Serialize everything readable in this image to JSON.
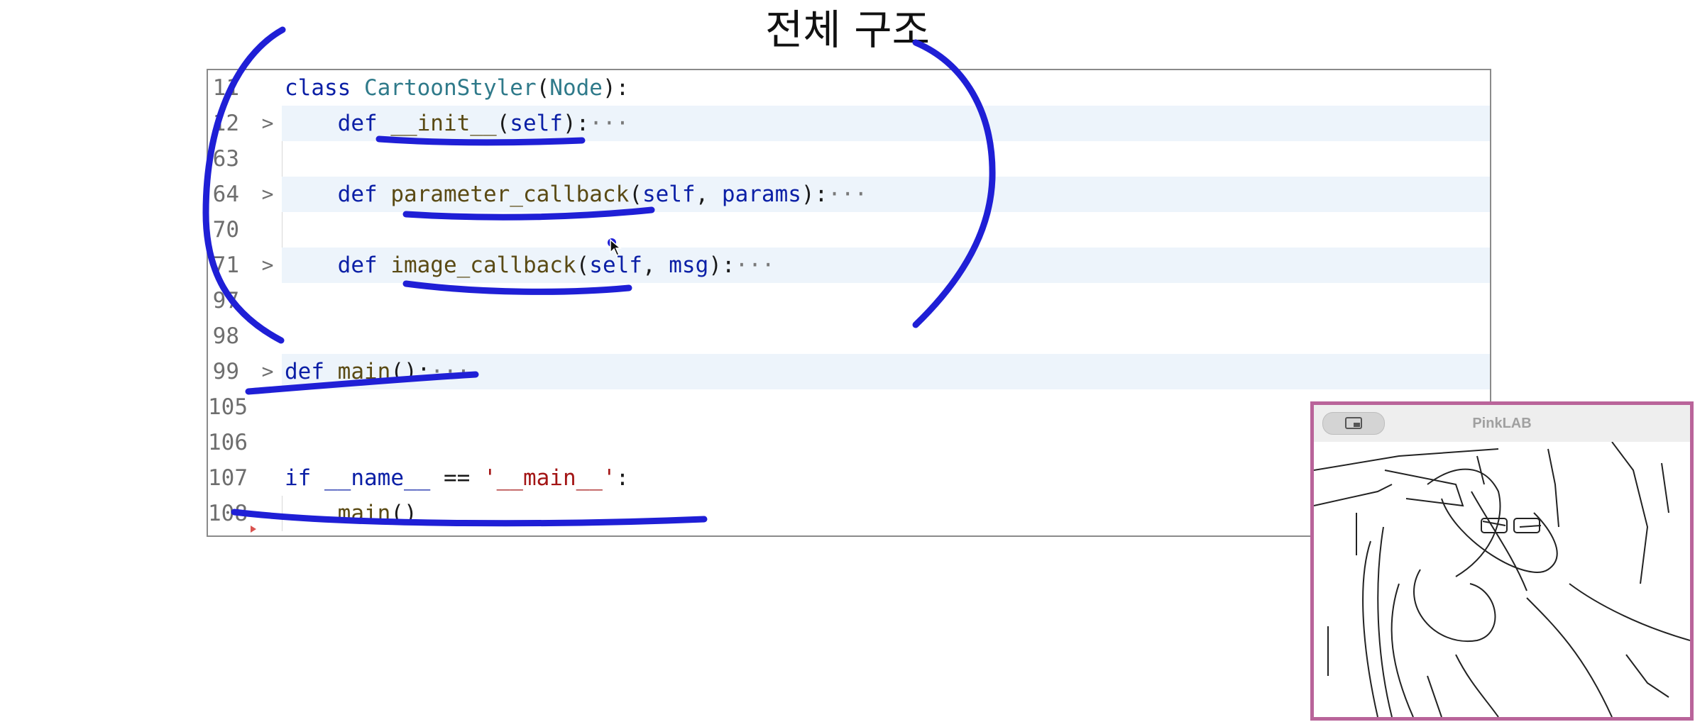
{
  "slide_title": "전체 구조",
  "editor": {
    "lines": [
      {
        "num": "11",
        "fold": false,
        "shaded": false,
        "guide": false,
        "indent": 0,
        "tokens": [
          {
            "t": "class ",
            "c": "kw"
          },
          {
            "t": "CartoonStyler",
            "c": "cls"
          },
          {
            "t": "(",
            "c": ""
          },
          {
            "t": "Node",
            "c": "cls"
          },
          {
            "t": "):",
            "c": ""
          }
        ]
      },
      {
        "num": "12",
        "fold": true,
        "shaded": true,
        "guide": true,
        "indent": 1,
        "tokens": [
          {
            "t": "def ",
            "c": "kw"
          },
          {
            "t": "__init__",
            "c": "fn"
          },
          {
            "t": "(",
            "c": ""
          },
          {
            "t": "self",
            "c": "kw"
          },
          {
            "t": "):",
            "c": ""
          },
          {
            "t": "···",
            "c": "ellipsis"
          }
        ]
      },
      {
        "num": "63",
        "fold": false,
        "shaded": false,
        "guide": true,
        "indent": 0,
        "tokens": []
      },
      {
        "num": "64",
        "fold": true,
        "shaded": true,
        "guide": true,
        "indent": 1,
        "tokens": [
          {
            "t": "def ",
            "c": "kw"
          },
          {
            "t": "parameter_callback",
            "c": "fn"
          },
          {
            "t": "(",
            "c": ""
          },
          {
            "t": "self",
            "c": "kw"
          },
          {
            "t": ", ",
            "c": ""
          },
          {
            "t": "params",
            "c": "kw"
          },
          {
            "t": "):",
            "c": ""
          },
          {
            "t": "···",
            "c": "ellipsis"
          }
        ]
      },
      {
        "num": "70",
        "fold": false,
        "shaded": false,
        "guide": true,
        "indent": 0,
        "tokens": []
      },
      {
        "num": "71",
        "fold": true,
        "shaded": true,
        "guide": true,
        "indent": 1,
        "tokens": [
          {
            "t": "def ",
            "c": "kw"
          },
          {
            "t": "image_callback",
            "c": "fn"
          },
          {
            "t": "(",
            "c": ""
          },
          {
            "t": "self",
            "c": "kw"
          },
          {
            "t": ", ",
            "c": ""
          },
          {
            "t": "msg",
            "c": "kw"
          },
          {
            "t": "):",
            "c": ""
          },
          {
            "t": "···",
            "c": "ellipsis"
          }
        ]
      },
      {
        "num": "97",
        "fold": false,
        "shaded": false,
        "guide": false,
        "indent": 0,
        "tokens": []
      },
      {
        "num": "98",
        "fold": false,
        "shaded": false,
        "guide": false,
        "indent": 0,
        "tokens": []
      },
      {
        "num": "99",
        "fold": true,
        "shaded": true,
        "guide": false,
        "indent": 0,
        "tokens": [
          {
            "t": "def ",
            "c": "kw"
          },
          {
            "t": "main",
            "c": "fn"
          },
          {
            "t": "():",
            "c": ""
          },
          {
            "t": "···",
            "c": "ellipsis"
          }
        ]
      },
      {
        "num": "105",
        "fold": false,
        "shaded": false,
        "guide": false,
        "indent": 0,
        "tokens": []
      },
      {
        "num": "106",
        "fold": false,
        "shaded": false,
        "guide": false,
        "indent": 0,
        "tokens": []
      },
      {
        "num": "107",
        "fold": false,
        "shaded": false,
        "guide": false,
        "indent": 0,
        "tokens": [
          {
            "t": "if ",
            "c": "kw"
          },
          {
            "t": "__name__",
            "c": "kw"
          },
          {
            "t": " == ",
            "c": ""
          },
          {
            "t": "'__main__'",
            "c": "str"
          },
          {
            "t": ":",
            "c": ""
          }
        ]
      },
      {
        "num": "108",
        "fold": false,
        "shaded": false,
        "guide": true,
        "indent": 1,
        "tokens": [
          {
            "t": "main",
            "c": "fn"
          },
          {
            "t": "()",
            "c": ""
          }
        ]
      }
    ],
    "fold_glyph": ">"
  },
  "pip_window": {
    "title": "PinkLAB",
    "button_icon": "picture-in-picture-icon",
    "border_color": "#b9649a"
  },
  "annotation_color": "#1f1fd6"
}
